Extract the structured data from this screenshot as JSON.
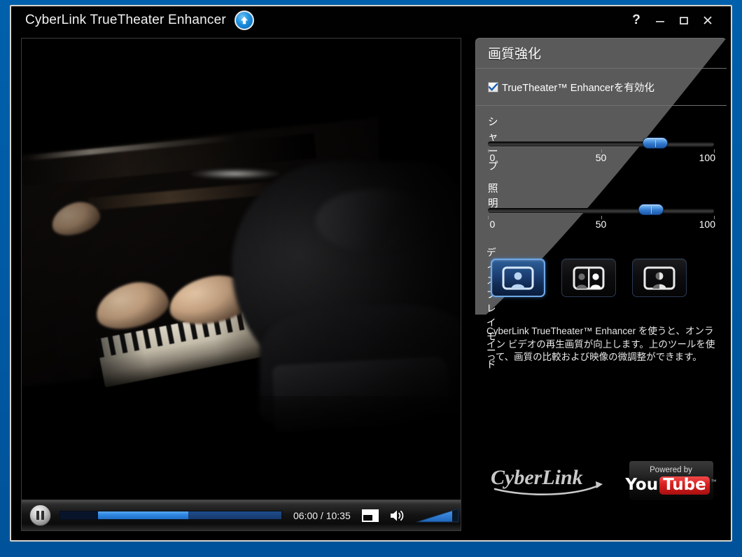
{
  "window": {
    "title": "CyberLink TrueTheater Enhancer",
    "upgrade_icon": "up-arrow-circle-icon",
    "controls": {
      "help": "?",
      "minimize": "minimize-icon",
      "maximize": "maximize-icon",
      "close": "close-icon"
    }
  },
  "player": {
    "state": "paused",
    "play_pause_icon": "pause-icon",
    "timecode": "06:00 / 10:35",
    "current_time": "06:00",
    "total_time": "10:35",
    "progress_percent": 58,
    "buffer_percent": 100,
    "start_marker_percent": 17,
    "fullscreen_icon": "fullscreen-icon",
    "volume_icon": "speaker-icon",
    "volume_percent": 85
  },
  "panel": {
    "title": "画質強化",
    "enable": {
      "label": "TrueTheater™ Enhancerを有効化",
      "checked": true,
      "icon": "checkmark-icon"
    },
    "sliders": [
      {
        "name": "sharpness",
        "label": "シャープ",
        "value": 74,
        "min": 0,
        "max": 100,
        "ticks": [
          "0",
          "50",
          "100"
        ]
      },
      {
        "name": "lighting",
        "label": "照明",
        "value": 72,
        "min": 0,
        "max": 100,
        "ticks": [
          "0",
          "50",
          "100"
        ]
      }
    ],
    "display_mode": {
      "label": "ディスプレイ モード",
      "selected_index": 0,
      "options": [
        {
          "name": "normal",
          "icon": "single-person-icon"
        },
        {
          "name": "split-compare",
          "icon": "split-two-person-icon"
        },
        {
          "name": "split-single",
          "icon": "half-split-person-icon"
        }
      ]
    },
    "description": "CyberLink TrueTheater™ Enhancer を使うと、オンライン ビデオの再生画質が向上します。上のツールを使って、画質の比較および映像の微調整ができます。",
    "branding": {
      "cyberlink": "CyberLink",
      "youtube_powered": "Powered by",
      "youtube_you": "You",
      "youtube_tube": "Tube",
      "youtube_tm": "™"
    }
  },
  "colors": {
    "desktop_blue": "#0061ad",
    "accent_blue": "#2f86e0",
    "panel_gray": "#5a5a5a",
    "window_black": "#000000",
    "youtube_red": "#d81f1f"
  }
}
